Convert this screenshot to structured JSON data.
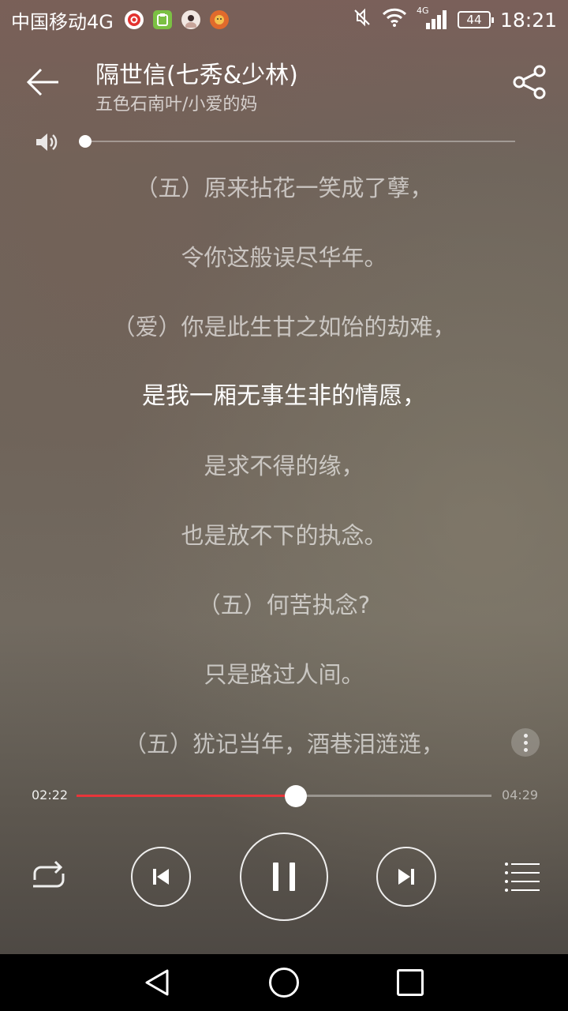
{
  "status_bar": {
    "carrier": "中国移动4G",
    "network_badge": "4G",
    "battery": "44",
    "time": "18:21",
    "icons": [
      "netease-music-icon",
      "clipboard-app-icon",
      "avatar-app-icon",
      "lion-app-icon",
      "mute-icon",
      "wifi-icon",
      "signal-icon",
      "battery-icon"
    ]
  },
  "header": {
    "title": "隔世信(七秀&少林)",
    "artist": "五色石南叶/小爱的妈",
    "back_icon": "arrow-left-icon",
    "share_icon": "share-icon"
  },
  "volume": {
    "icon": "speaker-icon",
    "level": 0.0
  },
  "lyrics": {
    "lines": [
      "（五）原来拈花一笑成了孽，",
      "令你这般误尽华年。",
      "（爱）你是此生甘之如饴的劫难，",
      "是我一厢无事生非的情愿，",
      "是求不得的缘，",
      "也是放不下的执念。",
      "（五）何苦执念?",
      "只是路过人间。",
      "（五）犹记当年，酒巷泪涟涟，"
    ],
    "active_index": 3
  },
  "progress": {
    "current": "02:22",
    "total": "04:29",
    "fraction": 0.528,
    "accent_color": "#e8353a"
  },
  "controls": {
    "icons": [
      "repeat-icon",
      "previous-icon",
      "pause-icon",
      "next-icon",
      "playlist-icon"
    ]
  },
  "nav_bar": {
    "icons": [
      "nav-back-icon",
      "nav-home-icon",
      "nav-recent-icon"
    ]
  }
}
